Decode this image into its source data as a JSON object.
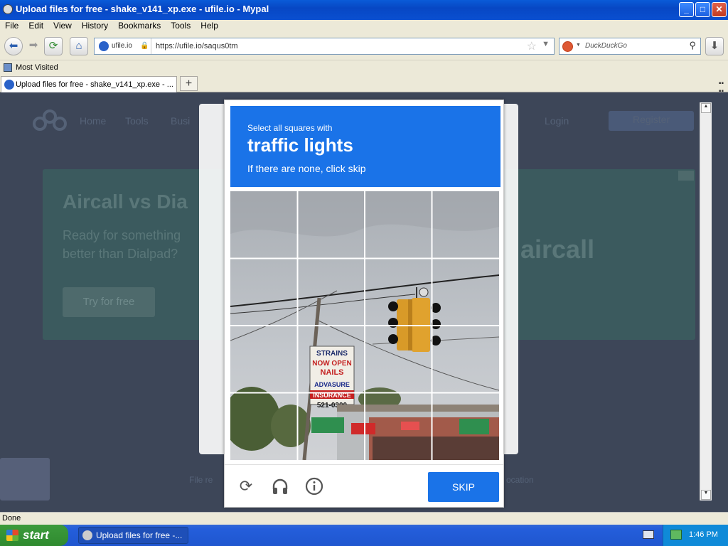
{
  "window": {
    "title": "Upload files for free - shake_v141_xp.exe - ufile.io - Mypal",
    "minimize": "_",
    "maximize": "□",
    "close": "✕"
  },
  "menu": [
    "File",
    "Edit",
    "View",
    "History",
    "Bookmarks",
    "Tools",
    "Help"
  ],
  "nav": {
    "back_icon": "back-arrow-icon",
    "forward_icon": "forward-arrow-icon",
    "reload_icon": "reload-icon",
    "home_icon": "home-icon",
    "download_icon": "download-icon",
    "identity": "ufile.io",
    "url": "https://ufile.io/saqus0tm",
    "search_placeholder": "DuckDuckGo"
  },
  "bookmarks": {
    "most_visited": "Most Visited"
  },
  "tabs": [
    {
      "label": "Upload files for free - shake_v141_xp.exe - ..."
    }
  ],
  "page_bg": {
    "nav": [
      "Home",
      "Tools",
      "Busi",
      "Login",
      "Register"
    ],
    "ad_heading": "Aircall vs Dia",
    "ad_sub": "Ready for something better than Dialpad?",
    "ad_button": "Try for free",
    "ad_logo": "aircall",
    "footer": [
      "File re",
      "ocation"
    ]
  },
  "captcha": {
    "line1": "Select all squares with",
    "target": "traffic lights",
    "line3": "If there are none, click skip",
    "skip": "SKIP",
    "icons": [
      "reload-icon",
      "audio-headphones-icon",
      "info-icon"
    ],
    "grid_rows": 4,
    "grid_cols": 4,
    "sign_text": [
      "STRAINS",
      "NOW OPEN",
      "NAILS",
      "ADVASURE",
      "INSURANCE",
      "521-0300"
    ]
  },
  "status": "Done",
  "taskbar": {
    "start": "start",
    "task": "Upload files for free -...",
    "clock": "1:46 PM"
  },
  "colors": {
    "accent": "#1a73e8",
    "xp_blue": "#245edb"
  }
}
